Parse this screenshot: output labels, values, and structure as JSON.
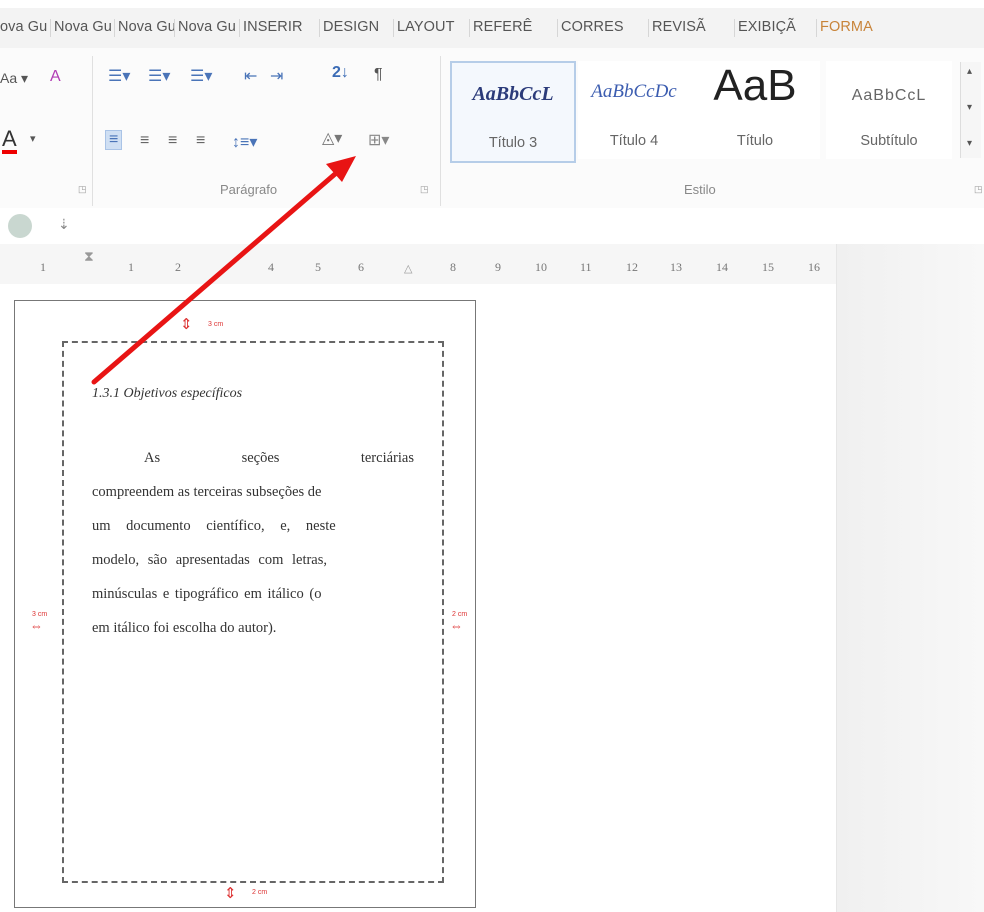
{
  "tabs": [
    "ova Gu",
    "Nova Gu",
    "Nova Gu",
    "INSERIR",
    "DESIGN",
    "LAYOUT",
    "REFERÊ",
    "CORRES",
    "REVISÃ",
    "EXIBIÇÃ",
    "FORMA"
  ],
  "ribbon": {
    "paragraph_label": "Parágrafo",
    "style_label": "Estilo",
    "styles": [
      {
        "sample": "AaBbCcL",
        "name": "Título 3"
      },
      {
        "sample": "AaBbCcDc",
        "name": "Título 4"
      },
      {
        "sample": "AaB",
        "name": "Título"
      },
      {
        "sample": "AaBbCcL",
        "name": "Subtítulo"
      }
    ]
  },
  "ruler": {
    "labels": [
      "1",
      "1",
      "2",
      "4",
      "5",
      "6",
      "8",
      "9",
      "10",
      "11",
      "12",
      "13",
      "14",
      "15",
      "16"
    ]
  },
  "document": {
    "heading": "1.3.1 Objetivos específicos",
    "lines": [
      "As seções terciárias",
      "compreendem as terceiras subseções de",
      "um documento científico, e, neste",
      "modelo, são apresentadas com letras,",
      "minúsculas e tipográfico em itálico (o",
      "em itálico foi escolha do autor)."
    ],
    "margin_top": "3 cm",
    "margin_left": "3 cm",
    "margin_right": "2 cm",
    "margin_bottom": "2 cm"
  },
  "colors": {
    "arrow": "#e81414",
    "active_tab": "#c8843a"
  }
}
